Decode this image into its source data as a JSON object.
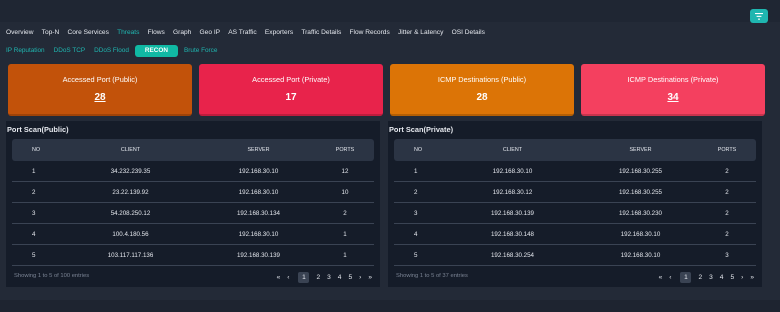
{
  "nav": {
    "tabs": [
      {
        "label": "Overview"
      },
      {
        "label": "Top-N"
      },
      {
        "label": "Core Services"
      },
      {
        "label": "Threats"
      },
      {
        "label": "Flows"
      },
      {
        "label": "Graph"
      },
      {
        "label": "Geo IP"
      },
      {
        "label": "AS Traffic"
      },
      {
        "label": "Exporters"
      },
      {
        "label": "Traffic Details"
      },
      {
        "label": "Flow Records"
      },
      {
        "label": "Jitter & Latency"
      },
      {
        "label": "OSI Details"
      }
    ],
    "active": "Threats"
  },
  "subnav": {
    "tabs": [
      {
        "label": "IP Reputation"
      },
      {
        "label": "DDoS TCP"
      },
      {
        "label": "DDoS Flood"
      },
      {
        "label": "RECON"
      },
      {
        "label": "Brute Force"
      }
    ],
    "active": "RECON"
  },
  "filter": {
    "icon": "filter-icon"
  },
  "cards": [
    {
      "title": "Accessed Port (Public)",
      "value": "28",
      "color": "#c2520a"
    },
    {
      "title": "Accessed Port (Private)",
      "value": "17",
      "color": "#e8234b"
    },
    {
      "title": "ICMP Destinations (Public)",
      "value": "28",
      "color": "#dc7406"
    },
    {
      "title": "ICMP Destinations (Private)",
      "value": "34",
      "color": "#f4405f"
    }
  ],
  "panels": [
    {
      "title": "Port Scan(Public)",
      "headers": {
        "no": "NO",
        "client": "CLIENT",
        "server": "SERVER",
        "ports": "PORTS"
      },
      "rows": [
        {
          "no": "1",
          "client": "34.232.239.35",
          "server": "192.168.30.10",
          "ports": "12"
        },
        {
          "no": "2",
          "client": "23.22.139.92",
          "server": "192.168.30.10",
          "ports": "10"
        },
        {
          "no": "3",
          "client": "54.208.250.12",
          "server": "192.168.30.134",
          "ports": "2"
        },
        {
          "no": "4",
          "client": "100.4.180.56",
          "server": "192.168.30.10",
          "ports": "1"
        },
        {
          "no": "5",
          "client": "103.117.117.136",
          "server": "192.168.30.139",
          "ports": "1"
        }
      ],
      "footer": "Showing 1 to 5 of 100 entries",
      "pages": [
        "«",
        "‹",
        "1",
        "2",
        "3",
        "4",
        "5",
        "›",
        "»"
      ],
      "current_page": "1"
    },
    {
      "title": "Port Scan(Private)",
      "headers": {
        "no": "NO",
        "client": "CLIENT",
        "server": "SERVER",
        "ports": "PORTS"
      },
      "rows": [
        {
          "no": "1",
          "client": "192.168.30.10",
          "server": "192.168.30.255",
          "ports": "2"
        },
        {
          "no": "2",
          "client": "192.168.30.12",
          "server": "192.168.30.255",
          "ports": "2"
        },
        {
          "no": "3",
          "client": "192.168.30.139",
          "server": "192.168.30.230",
          "ports": "2"
        },
        {
          "no": "4",
          "client": "192.168.30.148",
          "server": "192.168.30.10",
          "ports": "2"
        },
        {
          "no": "5",
          "client": "192.168.30.254",
          "server": "192.168.30.10",
          "ports": "3"
        }
      ],
      "footer": "Showing 1 to 5 of 37 entries",
      "pages": [
        "«",
        "‹",
        "1",
        "2",
        "3",
        "4",
        "5",
        "›",
        "»"
      ],
      "current_page": "1"
    }
  ]
}
